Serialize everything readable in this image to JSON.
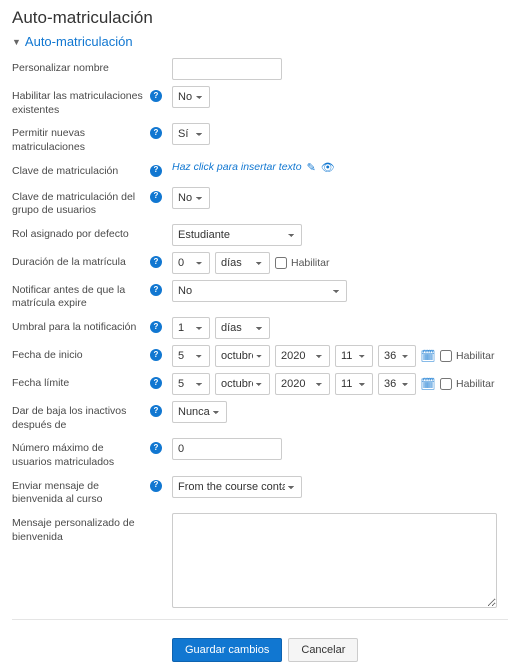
{
  "page_title": "Auto-matriculación",
  "section_title": "Auto-matriculación",
  "labels": {
    "custom_name": "Personalizar nombre",
    "existing_enrol": "Habilitar las matriculaciones existentes",
    "new_enrol": "Permitir nuevas matriculaciones",
    "enrol_key": "Clave de matriculación",
    "group_key": "Clave de matriculación del grupo de usuarios",
    "default_role": "Rol asignado por defecto",
    "duration": "Duración de la matrícula",
    "notify_before": "Notificar antes de que la matrícula expire",
    "threshold": "Umbral para la notificación",
    "start_date": "Fecha de inicio",
    "end_date": "Fecha límite",
    "unenrol_inactive": "Dar de baja los inactivos después de",
    "max_users": "Número máximo de usuarios matriculados",
    "welcome_msg": "Enviar mensaje de bienvenida al curso",
    "custom_welcome": "Mensaje personalizado de bienvenida"
  },
  "values": {
    "custom_name": "",
    "existing_enrol": "No",
    "new_enrol": "Sí",
    "enrol_key_link": "Haz click para insertar texto",
    "group_key": "No",
    "default_role": "Estudiante",
    "duration_num": "0",
    "duration_unit": "días",
    "notify_before": "No",
    "threshold_num": "1",
    "threshold_unit": "días",
    "start_day": "5",
    "start_month": "octubre",
    "start_year": "2020",
    "start_hour": "11",
    "start_min": "36",
    "end_day": "5",
    "end_month": "octubre",
    "end_year": "2020",
    "end_hour": "11",
    "end_min": "36",
    "unenrol_inactive": "Nunca",
    "max_users": "0",
    "welcome_msg": "From the course contact",
    "custom_welcome": ""
  },
  "misc": {
    "enable": "Habilitar",
    "save": "Guardar cambios",
    "cancel": "Cancelar"
  }
}
